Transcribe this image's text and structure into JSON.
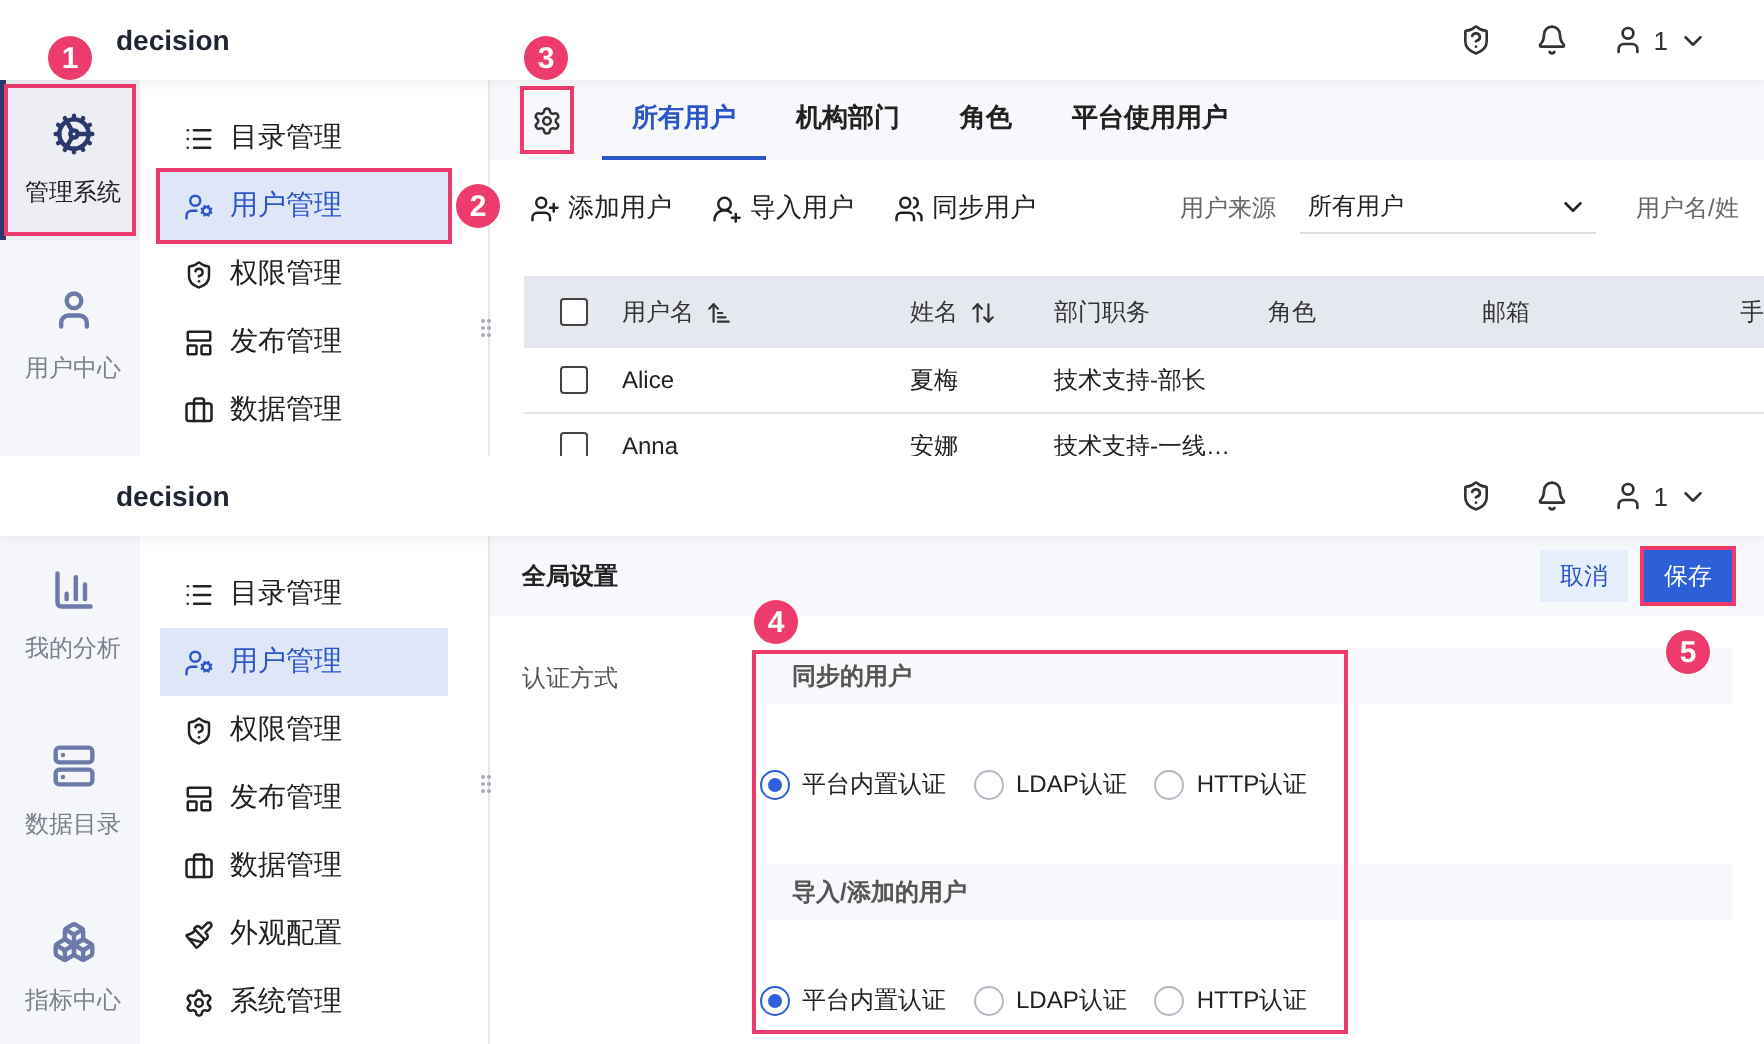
{
  "screens": [
    {
      "kind": "users",
      "app_title": "decision",
      "user": "1",
      "rail": [
        {
          "label": "管理系统",
          "selected": true,
          "callout": "1"
        },
        {
          "label": "用户中心",
          "selected": false
        }
      ],
      "menu": [
        {
          "label": "目录管理",
          "selected": false
        },
        {
          "label": "用户管理",
          "selected": true,
          "callout": "2"
        },
        {
          "label": "权限管理",
          "selected": false
        },
        {
          "label": "发布管理",
          "selected": false
        },
        {
          "label": "数据管理",
          "selected": false
        }
      ],
      "main": {
        "gear_callout": "3",
        "tabs": [
          {
            "label": "所有用户",
            "selected": true
          },
          {
            "label": "机构部门",
            "selected": false
          },
          {
            "label": "角色",
            "selected": false
          },
          {
            "label": "平台使用用户",
            "selected": false
          }
        ],
        "actions": [
          "添加用户",
          "导入用户",
          "同步用户"
        ],
        "filter": {
          "label": "用户来源",
          "value": "所有用户"
        },
        "search": {
          "placeholder": "用户名/姓"
        },
        "select_all_checked": false,
        "columns": [
          {
            "label": "用户名",
            "kind": "sort-asc"
          },
          {
            "label": "姓名",
            "kind": "sort-both"
          },
          {
            "label": "部门职务",
            "kind": "plain"
          },
          {
            "label": "角色",
            "kind": "plain"
          },
          {
            "label": "邮箱",
            "kind": "plain"
          },
          {
            "label": "手",
            "kind": "plain"
          }
        ],
        "rows": [
          {
            "checked": false,
            "cells": [
              "Alice",
              "夏梅",
              "技术支持-部长",
              "",
              "",
              ""
            ]
          },
          {
            "checked": false,
            "cells": [
              "Anna",
              "安娜",
              "技术支持-一线…",
              "",
              "",
              ""
            ]
          }
        ]
      }
    },
    {
      "kind": "settings",
      "app_title": "decision",
      "user": "1",
      "rail": [
        {
          "label": "我的分析",
          "selected": false
        },
        {
          "label": "数据目录",
          "selected": false
        },
        {
          "label": "指标中心",
          "selected": false
        }
      ],
      "menu": [
        {
          "label": "目录管理",
          "selected": false
        },
        {
          "label": "用户管理",
          "selected": true
        },
        {
          "label": "权限管理",
          "selected": false
        },
        {
          "label": "发布管理",
          "selected": false
        },
        {
          "label": "数据管理",
          "selected": false
        },
        {
          "label": "外观配置",
          "selected": false
        },
        {
          "label": "系统管理",
          "selected": false
        }
      ],
      "main": {
        "title": "全局设置",
        "buttons": [
          {
            "label": "取消",
            "kind": "secondary"
          },
          {
            "label": "保存",
            "kind": "primary",
            "callout": "5"
          }
        ],
        "field_label": "认证方式",
        "groups_callout": "4",
        "groups": [
          {
            "title": "同步的用户",
            "options": [
              {
                "label": "平台内置认证",
                "selected": true
              },
              {
                "label": "LDAP认证",
                "selected": false
              },
              {
                "label": "HTTP认证",
                "selected": false
              }
            ]
          },
          {
            "title": "导入/添加的用户",
            "options": [
              {
                "label": "平台内置认证",
                "selected": true
              },
              {
                "label": "LDAP认证",
                "selected": false
              },
              {
                "label": "HTTP认证",
                "selected": false
              }
            ]
          }
        ]
      }
    }
  ]
}
